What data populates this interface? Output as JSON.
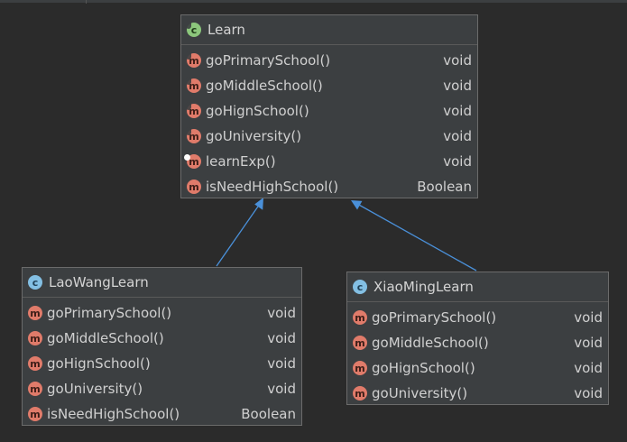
{
  "diagram": {
    "learn": {
      "name": "Learn",
      "icon": "abstract-class-icon",
      "members": [
        {
          "name": "goPrimarySchool()",
          "type": "void",
          "icon": "abstract-method-icon"
        },
        {
          "name": "goMiddleSchool()",
          "type": "void",
          "icon": "abstract-method-icon"
        },
        {
          "name": "goHignSchool()",
          "type": "void",
          "icon": "abstract-method-icon"
        },
        {
          "name": "goUniversity()",
          "type": "void",
          "icon": "abstract-method-icon"
        },
        {
          "name": "learnExp()",
          "type": "void",
          "icon": "protected-method-icon"
        },
        {
          "name": "isNeedHighSchool()",
          "type": "Boolean",
          "icon": "method-icon"
        }
      ]
    },
    "laowang": {
      "name": "LaoWangLearn",
      "icon": "class-icon",
      "members": [
        {
          "name": "goPrimarySchool()",
          "type": "void",
          "icon": "method-icon"
        },
        {
          "name": "goMiddleSchool()",
          "type": "void",
          "icon": "method-icon"
        },
        {
          "name": "goHignSchool()",
          "type": "void",
          "icon": "method-icon"
        },
        {
          "name": "goUniversity()",
          "type": "void",
          "icon": "method-icon"
        },
        {
          "name": "isNeedHighSchool()",
          "type": "Boolean",
          "icon": "method-icon"
        }
      ]
    },
    "xiaoming": {
      "name": "XiaoMingLearn",
      "icon": "class-icon",
      "members": [
        {
          "name": "goPrimarySchool()",
          "type": "void",
          "icon": "method-icon"
        },
        {
          "name": "goMiddleSchool()",
          "type": "void",
          "icon": "method-icon"
        },
        {
          "name": "goHignSchool()",
          "type": "void",
          "icon": "method-icon"
        },
        {
          "name": "goUniversity()",
          "type": "void",
          "icon": "method-icon"
        }
      ]
    }
  },
  "colors": {
    "background": "#2b2b2b",
    "box": "#3c3f41",
    "method_icon": "#e07b6a",
    "class_icon": "#83bfe3",
    "abstract_class_icon": "#8cc77c",
    "inheritance_arrow": "#4a90d9"
  }
}
